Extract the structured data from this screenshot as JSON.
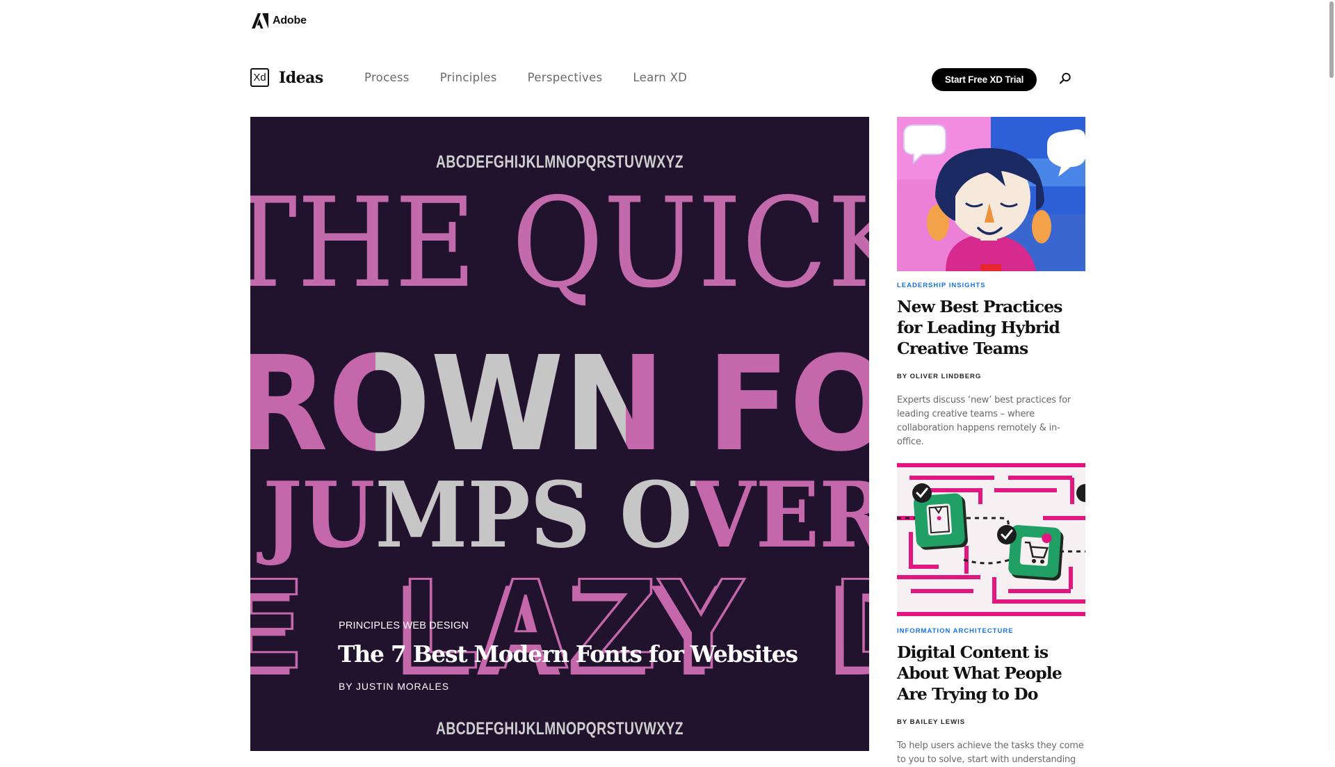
{
  "adobe": {
    "label": "Adobe"
  },
  "brand": {
    "badge": "Xd",
    "name": "Ideas"
  },
  "nav": {
    "items": [
      "Process",
      "Principles",
      "Perspectives",
      "Learn XD"
    ]
  },
  "cta": {
    "label": "Start Free XD Trial"
  },
  "hero": {
    "alphabet": "ABCDEFGHIJKLMNOPQRSTUVWXYZ",
    "line1": "THE QUICK",
    "line2": "ROWN FO",
    "line3": "JUMPS OVER",
    "line4": "E LAZY D",
    "category": "PRINCIPLES WEB DESIGN",
    "title": "The 7 Best Modern Fonts for Websites",
    "author": "BY JUSTIN MORALES"
  },
  "cards": [
    {
      "kicker": "LEADERSHIP INSIGHTS",
      "title": "New Best Practices for Leading Hybrid Creative Teams",
      "byline": "BY OLIVER LINDBERG",
      "excerpt": "Experts discuss ‘new’ best practices for leading creative teams – where collaboration happens remotely & in-office."
    },
    {
      "kicker": "INFORMATION ARCHITECTURE",
      "title": "Digital Content is About What People Are Trying to Do",
      "byline": "BY BAILEY LEWIS",
      "excerpt": "To help users achieve the tasks they come to you to solve, start with understanding"
    }
  ],
  "colors": {
    "accent": "#1473e6",
    "hero_bg": "#21122e",
    "hero_pink": "#c467ab",
    "hero_gray": "#c6c6c6",
    "cta_bg": "#000000"
  }
}
